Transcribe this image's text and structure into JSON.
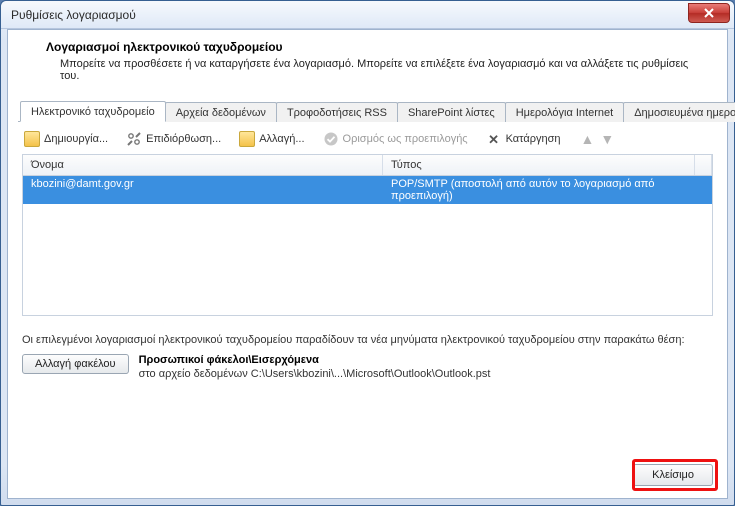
{
  "window": {
    "title": "Ρυθμίσεις λογαριασμού"
  },
  "header": {
    "title": "Λογαριασμοί ηλεκτρονικού ταχυδρομείου",
    "subtitle": "Μπορείτε να προσθέσετε ή να καταργήσετε ένα λογαριασμό. Μπορείτε να επιλέξετε ένα λογαριασμό και να αλλάξετε τις ρυθμίσεις του."
  },
  "tabs": [
    {
      "label": "Ηλεκτρονικό ταχυδρομείο",
      "active": true
    },
    {
      "label": "Αρχεία δεδομένων"
    },
    {
      "label": "Τροφοδοτήσεις RSS"
    },
    {
      "label": "SharePoint λίστες"
    },
    {
      "label": "Ημερολόγια Internet"
    },
    {
      "label": "Δημοσιευμένα ημερολόγ"
    }
  ],
  "toolbar": {
    "new": "Δημιουργία...",
    "repair": "Επιδιόρθωση...",
    "change": "Αλλαγή...",
    "setdefault": "Ορισμός ως προεπιλογής",
    "remove": "Κατάργηση"
  },
  "columns": {
    "name": "Όνομα",
    "type": "Τύπος"
  },
  "rows": [
    {
      "name": "kbozini@damt.gov.gr",
      "type": "POP/SMTP (αποστολή από αυτόν το λογαριασμό από προεπιλογή)"
    }
  ],
  "deliveryNote": "Οι επιλεγμένοι λογαριασμοί ηλεκτρονικού ταχυδρομείου παραδίδουν τα νέα μηνύματα ηλεκτρονικού ταχυδρομείου στην παρακάτω θέση:",
  "changeFolderBtn": "Αλλαγή φακέλου",
  "folder": {
    "title": "Προσωπικοί φάκελοι\\Εισερχόμενα",
    "path": "στο αρχείο δεδομένων C:\\Users\\kbozini\\...\\Microsoft\\Outlook\\Outlook.pst"
  },
  "closeBtn": "Κλείσιμο"
}
